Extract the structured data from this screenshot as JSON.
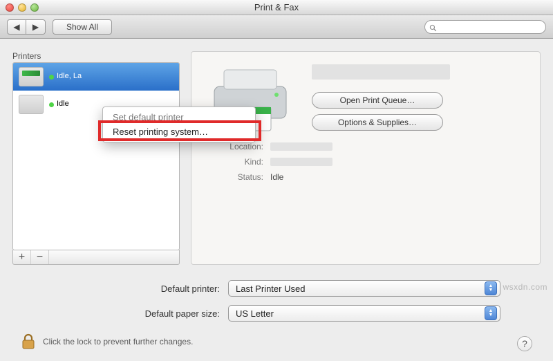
{
  "window": {
    "title": "Print & Fax"
  },
  "toolbar": {
    "back_arrow": "◀",
    "fwd_arrow": "▶",
    "show_all": "Show All",
    "search_placeholder": ""
  },
  "sidebar": {
    "label": "Printers",
    "items": [
      {
        "name": "",
        "sub": "Idle, La",
        "selected": true,
        "icon": "inkjet"
      },
      {
        "name": "",
        "sub": "Idle",
        "selected": false,
        "icon": "laser"
      }
    ],
    "add_glyph": "+",
    "remove_glyph": "−"
  },
  "context_menu": {
    "items": [
      "Set default printer",
      "Reset printing system…"
    ]
  },
  "detail": {
    "open_queue": "Open Print Queue…",
    "options_supplies": "Options & Supplies…",
    "location_label": "Location:",
    "kind_label": "Kind:",
    "status_label": "Status:",
    "status_value": "Idle"
  },
  "defaults": {
    "printer_label": "Default printer:",
    "printer_value": "Last Printer Used",
    "paper_label": "Default paper size:",
    "paper_value": "US Letter"
  },
  "lock": {
    "text": "Click the lock to prevent further changes."
  },
  "help_glyph": "?",
  "watermark": "wsxdn.com"
}
